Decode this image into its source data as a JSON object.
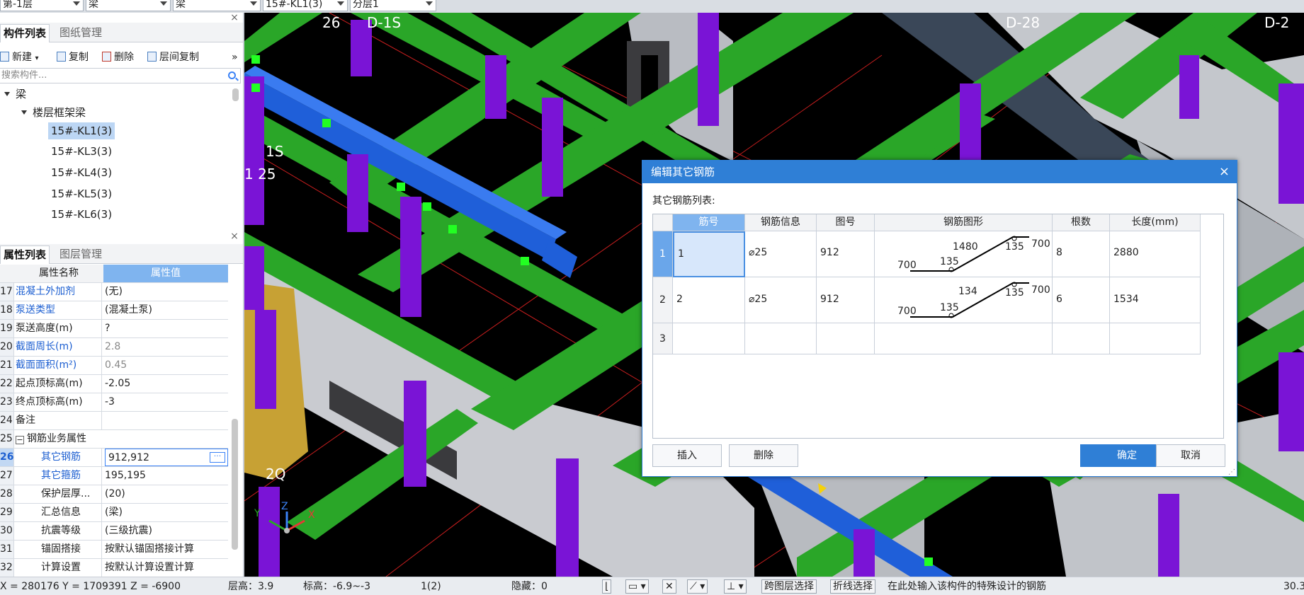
{
  "topbar": {
    "floor_combo": "第-1层",
    "type_combo": "梁",
    "subtype_combo": "梁",
    "member_combo": "15#-KL1(3)",
    "layer_combo": "分层1"
  },
  "component_panel": {
    "tab_active": "构件列表",
    "tab_inactive": "图纸管理",
    "toolbar": {
      "new": "新建",
      "copy": "复制",
      "delete": "删除",
      "floor_copy": "层间复制"
    },
    "search_placeholder": "搜索构件...",
    "tree": {
      "root": "梁",
      "group": "楼层框架梁",
      "items": [
        "15#-KL1(3)",
        "15#-KL3(3)",
        "15#-KL4(3)",
        "15#-KL5(3)",
        "15#-KL6(3)"
      ]
    }
  },
  "property_panel": {
    "tab_active": "属性列表",
    "tab_inactive": "图层管理",
    "header_name": "属性名称",
    "header_value": "属性值",
    "rows": [
      {
        "num": "17",
        "name": "混凝土外加剂",
        "value": "(无)"
      },
      {
        "num": "18",
        "name": "泵送类型",
        "value": "(混凝土泵)"
      },
      {
        "num": "19",
        "name": "泵送高度(m)",
        "value": "?"
      },
      {
        "num": "20",
        "name": "截面周长(m)",
        "value": "2.8"
      },
      {
        "num": "21",
        "name": "截面面积(m²)",
        "value": "0.45"
      },
      {
        "num": "22",
        "name": "起点顶标高(m)",
        "value": "-2.05"
      },
      {
        "num": "23",
        "name": "终点顶标高(m)",
        "value": "-3"
      },
      {
        "num": "24",
        "name": "备注",
        "value": ""
      },
      {
        "num": "25",
        "name": "钢筋业务属性",
        "value": ""
      },
      {
        "num": "26",
        "name": "其它钢筋",
        "value": "912,912"
      },
      {
        "num": "27",
        "name": "其它箍筋",
        "value": "195,195"
      },
      {
        "num": "28",
        "name": "保护层厚...",
        "value": "(20)"
      },
      {
        "num": "29",
        "name": "汇总信息",
        "value": "(梁)"
      },
      {
        "num": "30",
        "name": "抗震等级",
        "value": "(三级抗震)"
      },
      {
        "num": "31",
        "name": "锚固搭接",
        "value": "按默认锚固搭接计算"
      },
      {
        "num": "32",
        "name": "计算设置",
        "value": "按默认计算设置计算"
      }
    ]
  },
  "viewport": {
    "axis_labels": [
      "26",
      "D-1S",
      "D-28",
      "D-2",
      "1S",
      "1 25",
      "2Q"
    ],
    "gizmo": {
      "x": "X",
      "y": "Y",
      "z": "Z"
    },
    "colors": {
      "beam_green": "#2aa628",
      "column_purple": "#7a14d6",
      "beam_blue": "#1f5fd9",
      "wall_gray": "#b9bcc2",
      "dark_beam": "#3a4758",
      "grid_red": "#c81e1e"
    }
  },
  "dialog": {
    "title": "编辑其它钢筋",
    "close": "×",
    "list_label": "其它钢筋列表:",
    "columns": [
      "筋号",
      "钢筋信息",
      "图号",
      "钢筋图形",
      "根数",
      "长度(mm)"
    ],
    "rows": [
      {
        "row_num": "1",
        "bar_no": "1",
        "info": "⌀25",
        "fig_no": "912",
        "shape": {
          "left": "700",
          "bend1": "135",
          "slope": "1480",
          "bend2": "135",
          "right": "700"
        },
        "count": "8",
        "length": "2880"
      },
      {
        "row_num": "2",
        "bar_no": "2",
        "info": "⌀25",
        "fig_no": "912",
        "shape": {
          "left": "700",
          "bend1": "135",
          "slope": "134",
          "bend2": "135",
          "right": "700"
        },
        "count": "6",
        "length": "1534"
      },
      {
        "row_num": "3",
        "bar_no": "",
        "info": "",
        "fig_no": "",
        "count": "",
        "length": ""
      }
    ],
    "buttons": {
      "insert": "插入",
      "delete": "删除",
      "ok": "确定",
      "cancel": "取消"
    }
  },
  "statusbar": {
    "coords": "X = 280176 Y = 1709391 Z = -6900",
    "floor_height": "层高：3.9",
    "elevation": "标高：-6.9~-3",
    "count": "1(2)",
    "hidden": "隐藏：0",
    "btn_cross_layer": "跨图层选择",
    "btn_polyline": "折线选择",
    "hint": "在此处输入该构件的特殊设计的钢筋",
    "right_value": "30.3"
  }
}
